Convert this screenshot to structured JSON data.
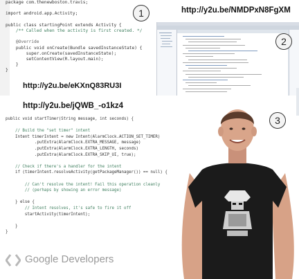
{
  "panel1": {
    "badge": "1",
    "code_lines": [
      {
        "text": "package com.thenewboston.travis;",
        "cls": ""
      },
      {
        "text": "",
        "cls": ""
      },
      {
        "text": "import android.app.Activity;",
        "cls": ""
      },
      {
        "text": "",
        "cls": ""
      },
      {
        "text": "public class startingPoint extends Activity {",
        "cls": ""
      },
      {
        "text": "    /** Called when the activity is first created. */",
        "cls": "cm"
      },
      {
        "text": "",
        "cls": ""
      },
      {
        "text": "    @Override",
        "cls": "an"
      },
      {
        "text": "    public void onCreate(Bundle savedInstanceState) {",
        "cls": ""
      },
      {
        "text": "        super.onCreate(savedInstanceState);",
        "cls": ""
      },
      {
        "text": "        setContentView(R.layout.main);",
        "cls": ""
      },
      {
        "text": "    }",
        "cls": ""
      },
      {
        "text": "}",
        "cls": ""
      }
    ]
  },
  "panel2": {
    "badge": "2",
    "url": "http://y2u.be/NMDPxN8FgXM"
  },
  "url_panel1": "http://y2u.be/eKXnQ83RU3I",
  "url_panel3": "http://y2u.be/jQWB_-o1kz4",
  "panel3": {
    "badge": "3",
    "code_lines": [
      "public void startTimer(String message, int seconds) {",
      "",
      "    // Build the \"set timer\" intent",
      "    Intent timerIntent = new Intent(AlarmClock.ACTION_SET_TIMER)",
      "            .putExtra(AlarmClock.EXTRA_MESSAGE, message)",
      "            .putExtra(AlarmClock.EXTRA_LENGTH, seconds)",
      "            .putExtra(AlarmClock.EXTRA_SKIP_UI, true);",
      "",
      "    // Check if there's a handler for the intent",
      "    if (timerIntent.resolveActivity(getPackageManager()) == null) {",
      "",
      "        // Can't resolve the intent! Fail this operation cleanly",
      "        // (perhaps by showing an error message)",
      "",
      "    } else {",
      "        // Intent resolves, it's safe to fire it off",
      "        startActivity(timerIntent);",
      "",
      "    }",
      "}"
    ],
    "logo_text": "Google Developers"
  },
  "colors": {
    "keyword": "#7f0055",
    "comment": "#3f7f5f",
    "shirt": "#1b1b1b",
    "skin": "#d9a58a"
  }
}
